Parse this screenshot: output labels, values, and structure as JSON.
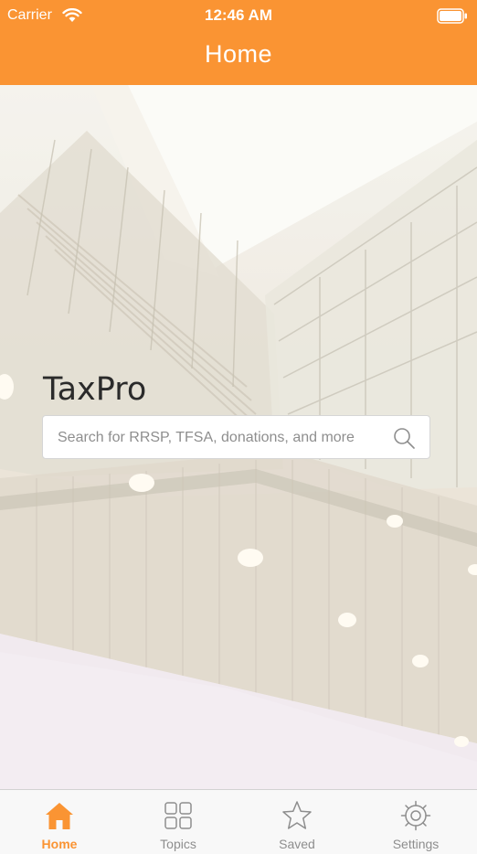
{
  "status_bar": {
    "carrier": "Carrier",
    "time": "12:46 AM"
  },
  "nav": {
    "title": "Home"
  },
  "hero": {
    "app_title": "TaxPro"
  },
  "search": {
    "placeholder": "Search for RRSP, TFSA, donations, and more",
    "value": ""
  },
  "tabs": [
    {
      "label": "Home",
      "icon": "home-icon",
      "active": true
    },
    {
      "label": "Topics",
      "icon": "topics-grid-icon",
      "active": false
    },
    {
      "label": "Saved",
      "icon": "star-icon",
      "active": false
    },
    {
      "label": "Settings",
      "icon": "gear-icon",
      "active": false
    }
  ],
  "colors": {
    "accent": "#fa9433",
    "tab_inactive": "#8e8e8e"
  }
}
